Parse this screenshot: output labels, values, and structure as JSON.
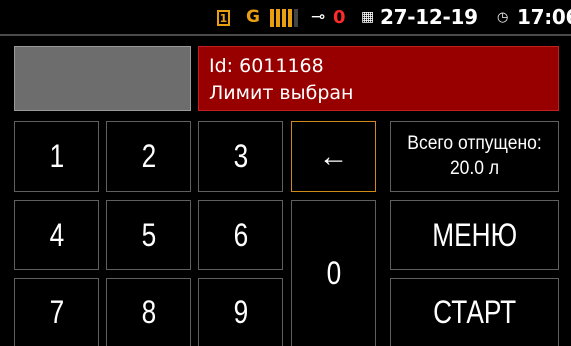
{
  "status_bar": {
    "sim_slot": "1",
    "network": "G",
    "signal_bars": 5,
    "signal_level": 0.8,
    "pump_count": "0",
    "date": "27-12-19",
    "time": "17:06",
    "colors": {
      "accent": "#e8a010",
      "alert": "#ff2a2a"
    },
    "icons": [
      "sim-card-icon",
      "signal-bars-icon",
      "pump-icon",
      "calendar-icon",
      "clock-icon"
    ]
  },
  "message": {
    "line1": "Id: 6011168",
    "line2": "Лимит выбран",
    "background": "#980000"
  },
  "keypad": {
    "keys": [
      "1",
      "2",
      "3",
      "4",
      "5",
      "6",
      "7",
      "8",
      "9",
      "0"
    ],
    "backspace_glyph": "←"
  },
  "total": {
    "label": "Всего отпущено:",
    "value": "20.0 л"
  },
  "buttons": {
    "menu": "МЕНЮ",
    "start": "СТАРТ"
  }
}
